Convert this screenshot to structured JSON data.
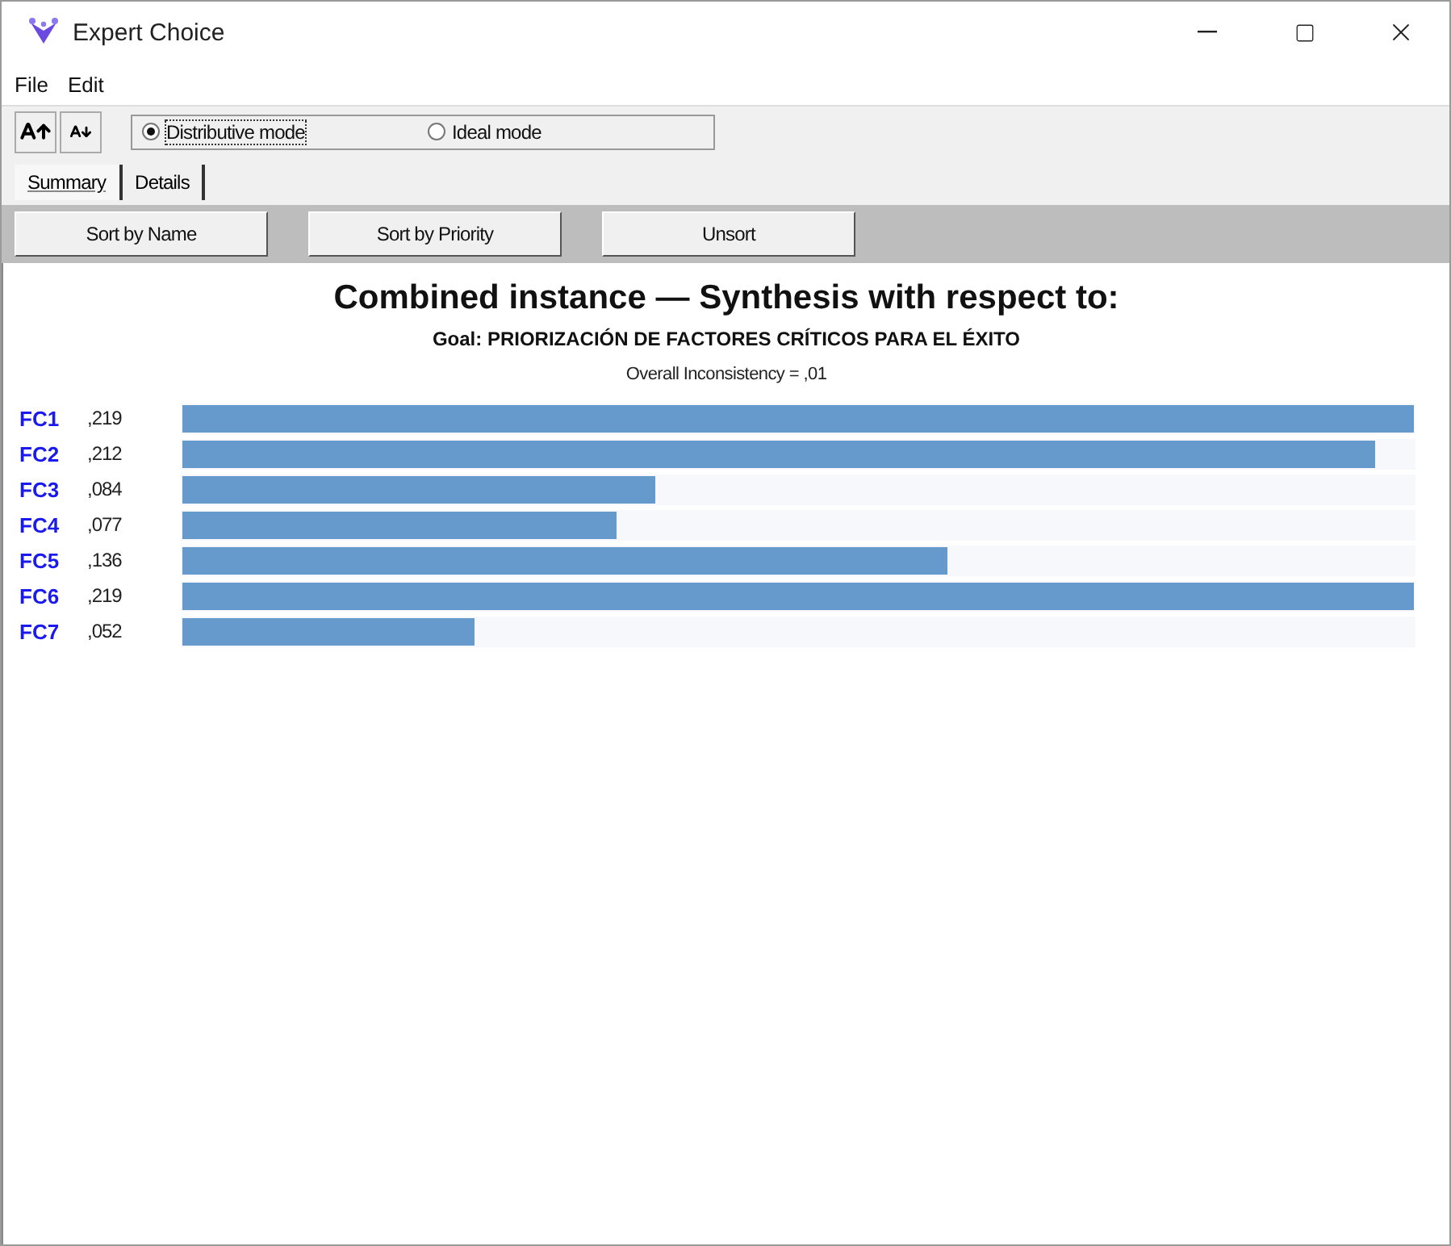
{
  "window": {
    "title": "Expert Choice"
  },
  "menu": [
    "File",
    "Edit"
  ],
  "modes": [
    {
      "label": "Distributive mode",
      "selected": true
    },
    {
      "label": "Ideal mode",
      "selected": false
    }
  ],
  "tabs": [
    {
      "label": "Summary",
      "selected": true
    },
    {
      "label": "Details",
      "selected": false
    }
  ],
  "buttons": [
    "Sort by Name",
    "Sort by Priority",
    "Unsort"
  ],
  "report": {
    "title": "Combined instance — Synthesis with respect to:",
    "goal": "Goal: PRIORIZACIÓN DE FACTORES CRÍTICOS PARA EL ÉXITO",
    "inconsistency": "Overall Inconsistency = ,01",
    "rows": [
      {
        "name": "FC1",
        "value": ",219",
        "level": 1
      },
      {
        "name": "FC2",
        "value": ",212",
        "level": 0.968
      },
      {
        "name": "FC3",
        "value": ",084",
        "level": 0.384
      },
      {
        "name": "FC4",
        "value": ",077",
        "level": 0.352
      },
      {
        "name": "FC5",
        "value": ",136",
        "level": 0.621
      },
      {
        "name": "FC6",
        "value": ",219",
        "level": 1
      },
      {
        "name": "FC7",
        "value": ",052",
        "level": 0.237
      }
    ]
  }
}
